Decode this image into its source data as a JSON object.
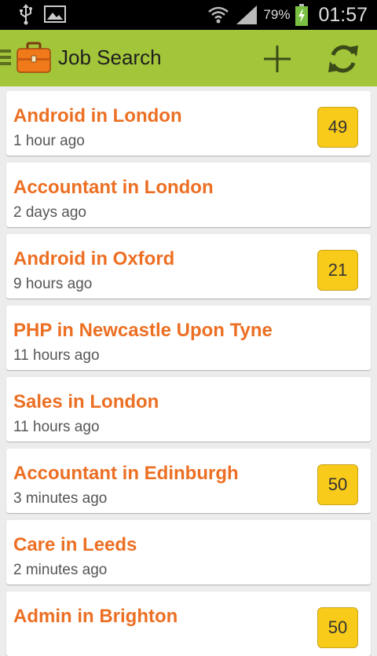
{
  "status_bar": {
    "battery_percent": "79%",
    "time": "01:57",
    "icons": [
      "usb-icon",
      "image-icon",
      "wifi-icon",
      "signal-icon",
      "battery-charging-icon"
    ]
  },
  "action_bar": {
    "title": "Job Search",
    "color": "#a3c53a",
    "actions": [
      "add-icon",
      "refresh-icon"
    ]
  },
  "jobs": [
    {
      "title": "Android in London",
      "time": "1 hour ago",
      "count": "49"
    },
    {
      "title": "Accountant in London",
      "time": "2 days ago",
      "count": null
    },
    {
      "title": "Android in Oxford",
      "time": "9 hours ago",
      "count": "21"
    },
    {
      "title": "PHP in Newcastle Upon Tyne",
      "time": "11 hours ago",
      "count": null
    },
    {
      "title": "Sales in London",
      "time": "11 hours ago",
      "count": null
    },
    {
      "title": "Accountant in Edinburgh",
      "time": "3 minutes ago",
      "count": "50"
    },
    {
      "title": "Care in Leeds",
      "time": "2 minutes ago",
      "count": null
    },
    {
      "title": "Admin in Brighton",
      "time": "",
      "count": "50"
    }
  ],
  "colors": {
    "title_orange": "#ec6f23",
    "badge_yellow": "#f8cb1b"
  }
}
